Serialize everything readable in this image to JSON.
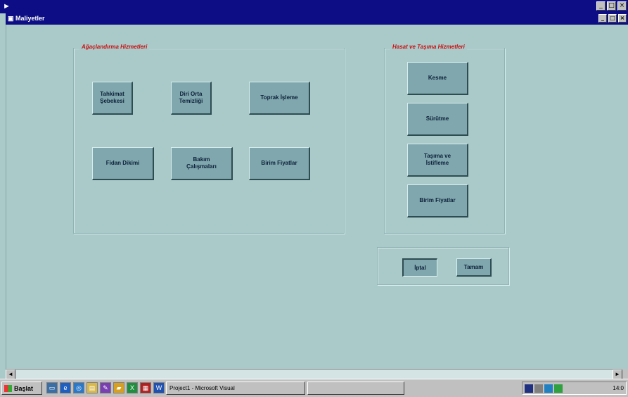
{
  "outer_window": {
    "controls": [
      "_",
      "□",
      "×"
    ]
  },
  "form": {
    "title": "Maliyetler",
    "controls": [
      "_",
      "□",
      "×"
    ]
  },
  "left_group": {
    "caption": "Ağaçlandırma Hizmetleri",
    "buttons": [
      {
        "label": "Tahkimat\nŞebekesi"
      },
      {
        "label": "Diri Orta\nTemizliği"
      },
      {
        "label": "Toprak İşleme"
      },
      {
        "label": "Fidan Dikimi"
      },
      {
        "label": "Bakım\nÇalışmaları"
      },
      {
        "label": "Birim Fiyatlar"
      }
    ]
  },
  "right_group": {
    "caption": "Hasat ve Taşıma Hizmetleri",
    "buttons": [
      {
        "label": "Kesme"
      },
      {
        "label": "Sürütme"
      },
      {
        "label": "Taşıma ve\nİstifleme"
      },
      {
        "label": "Birim Fiyatlar"
      }
    ]
  },
  "dialog_buttons": {
    "cancel": "İptal",
    "ok": "Tamam"
  },
  "taskbar": {
    "start_label": "Başlat",
    "task_project": "Project1 - Microsoft Visual",
    "task_second": "",
    "clock": "14:0"
  },
  "colors": {
    "form_background": "#aac9c9",
    "button_face": "#7fa7ad",
    "caption_red": "#cc1010",
    "titlebar_blue": "#0d0e85"
  },
  "icons": {
    "quick_launch": [
      "desktop-icon",
      "ie-icon",
      "outlook-icon",
      "explorer-icon",
      "vb-icon",
      "folder-icon",
      "excel-icon",
      "access-icon",
      "word-icon"
    ],
    "tray": [
      "network-icon",
      "volume-icon",
      "antivirus-icon",
      "messenger-icon"
    ]
  }
}
